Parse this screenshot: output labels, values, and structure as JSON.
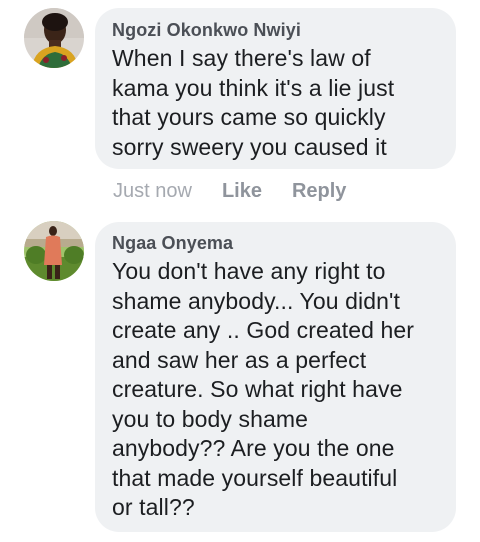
{
  "comments": [
    {
      "author": "Ngozi Okonkwo Nwiyi",
      "lines": [
        "When I say there's law of",
        "kama you think it's a lie just",
        "that yours came so quickly",
        "sorry sweery you caused it"
      ],
      "time": "Just now",
      "like_label": "Like",
      "reply_label": "Reply"
    },
    {
      "author": "Ngaa Onyema",
      "lines": [
        "You don't have any right to",
        "shame anybody... You didn't",
        "create any .. God created her",
        "and saw her as a perfect",
        "creature. So what right have",
        "you to body shame",
        "anybody?? Are you the one",
        "that made yourself beautiful",
        "or tall??"
      ]
    }
  ],
  "colors": {
    "bubble": "#eff1f3",
    "author": "#4b4f56",
    "text": "#1c1e21",
    "meta": "#a5a9b0"
  }
}
